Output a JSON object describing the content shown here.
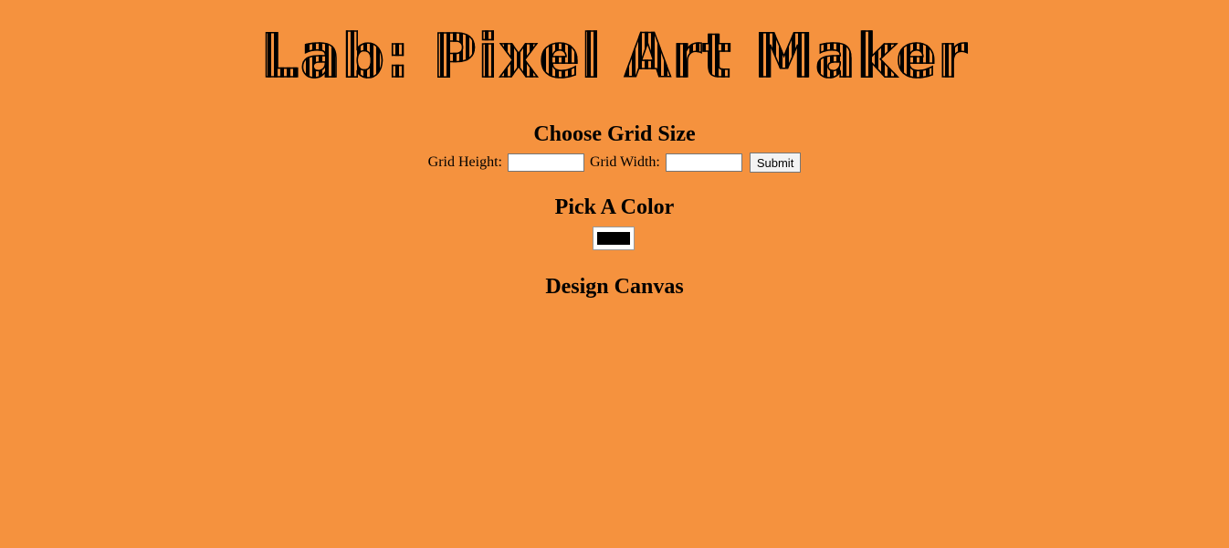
{
  "title": "Lab: Pixel Art Maker",
  "grid_section": {
    "heading": "Choose Grid Size",
    "height_label": "Grid Height:",
    "height_value": "",
    "width_label": "Grid Width:",
    "width_value": "",
    "submit_label": "Submit"
  },
  "color_section": {
    "heading": "Pick A Color",
    "selected_color": "#000000"
  },
  "canvas_section": {
    "heading": "Design Canvas"
  },
  "colors": {
    "background": "#f5923e",
    "text": "#000000"
  }
}
